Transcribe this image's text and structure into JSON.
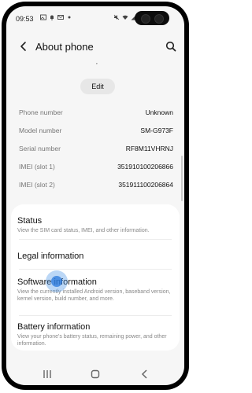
{
  "status_bar": {
    "time": "09:53",
    "left_icons": [
      "gallery-icon",
      "notification-icon",
      "mail-icon",
      "dot-icon"
    ],
    "right_icons": [
      "mute-icon",
      "wifi-icon",
      "signal-icon",
      "battery-icon"
    ]
  },
  "header": {
    "title": "About phone"
  },
  "profile": {
    "mark": "’",
    "edit_label": "Edit"
  },
  "info": [
    {
      "label": "Phone number",
      "value": "Unknown"
    },
    {
      "label": "Model number",
      "value": "SM-G973F"
    },
    {
      "label": "Serial number",
      "value": "RF8M11VHRNJ"
    },
    {
      "label": "IMEI (slot 1)",
      "value": "351910100206866"
    },
    {
      "label": "IMEI (slot 2)",
      "value": "351911100206864"
    }
  ],
  "menu": [
    {
      "title": "Status",
      "desc": "View the SIM card status, IMEI, and other information."
    },
    {
      "title": "Legal information",
      "desc": ""
    },
    {
      "title": "Software information",
      "desc": "View the currently installed Android version, baseband version, kernel version, build number, and more."
    },
    {
      "title": "Battery information",
      "desc": "View your phone's battery status, remaining power, and other information."
    }
  ],
  "nav": [
    "recents-icon",
    "home-icon",
    "back-icon"
  ]
}
